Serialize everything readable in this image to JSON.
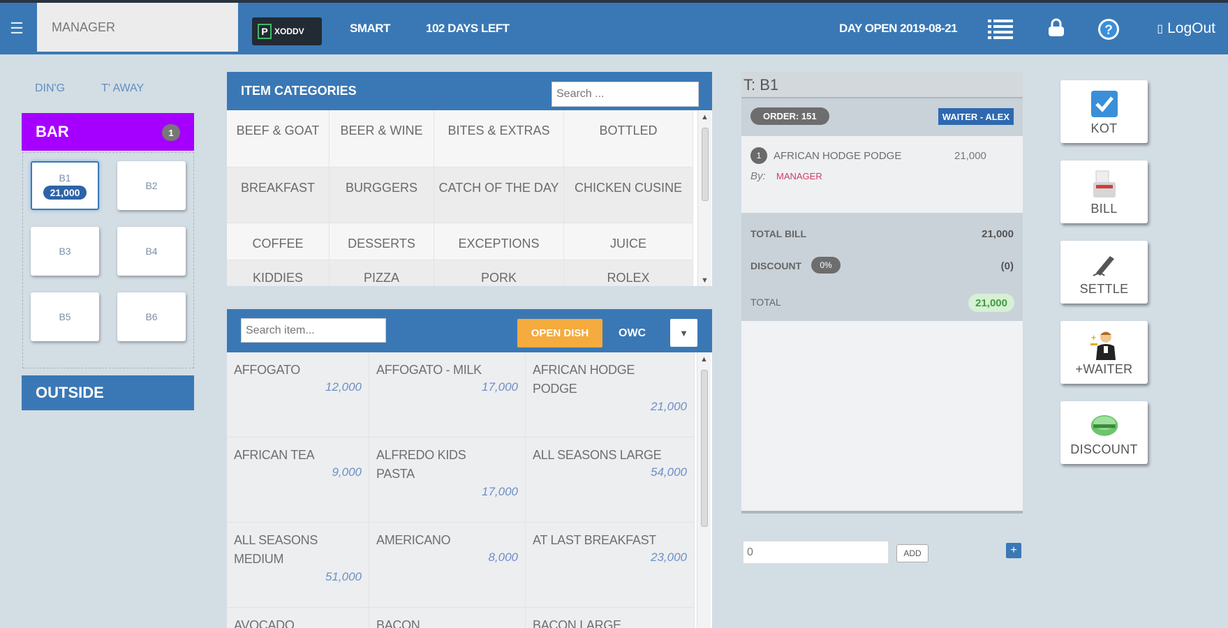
{
  "header": {
    "user": "MANAGER",
    "brand_mark": "P",
    "brand_text": "XODDV",
    "plan": "SMART",
    "days_left": "102 DAYS LEFT",
    "day_open": "DAY OPEN 2019-08-21",
    "logout": "LogOut"
  },
  "left": {
    "tabs": [
      "DIN'G",
      "T' AWAY"
    ],
    "section_bar": {
      "label": "BAR",
      "count": "1"
    },
    "tables": [
      {
        "name": "B1",
        "amount": "21,000"
      },
      {
        "name": "B2"
      },
      {
        "name": "B3"
      },
      {
        "name": "B4"
      },
      {
        "name": "B5"
      },
      {
        "name": "B6"
      }
    ],
    "section_outside": "OUTSIDE"
  },
  "categories": {
    "title": "ITEM CATEGORIES",
    "search_placeholder": "Search ...",
    "items": [
      "BEEF & GOAT",
      "BEER & WINE",
      "BITES & EXTRAS",
      "BOTTLED",
      "BREAKFAST",
      "BURGGERS",
      "CATCH OF THE DAY",
      "CHICKEN CUSINE",
      "COFFEE",
      "DESSERTS",
      "EXCEPTIONS",
      "JUICE",
      "KIDDIES",
      "PIZZA",
      "PORK",
      "ROLEX"
    ]
  },
  "menu_items": {
    "search_placeholder": "Search item...",
    "open_dish": "OPEN DISH",
    "owc": "OWC",
    "items": [
      {
        "name": "AFFOGATO",
        "price": "12,000"
      },
      {
        "name": "AFFOGATO - MILK",
        "price": "17,000"
      },
      {
        "name": "AFRICAN HODGE PODGE",
        "price": "21,000"
      },
      {
        "name": "AFRICAN TEA",
        "price": "9,000"
      },
      {
        "name": "ALFREDO KIDS PASTA",
        "price": "17,000"
      },
      {
        "name": "ALL SEASONS LARGE",
        "price": "54,000"
      },
      {
        "name": "ALL SEASONS MEDIUM",
        "price": "51,000"
      },
      {
        "name": "AMERICANO",
        "price": "8,000"
      },
      {
        "name": "AT LAST BREAKFAST",
        "price": "23,000"
      },
      {
        "name": "AVOCADO",
        "price": ""
      },
      {
        "name": "BACON",
        "price": ""
      },
      {
        "name": "BACON LARGE",
        "price": ""
      }
    ]
  },
  "order": {
    "title": "T: B1",
    "order_no": "ORDER: 151",
    "waiter": "WAITER - ALEX",
    "line": {
      "qty": "1",
      "name": "AFRICAN HODGE PODGE",
      "amount": "21,000",
      "by_label": "By:",
      "by_name": "MANAGER"
    },
    "total_bill_label": "TOTAL BILL",
    "total_bill": "21,000",
    "discount_label": "DISCOUNT",
    "discount_pct": "0%",
    "discount_val": "(0)",
    "total_label": "TOTAL",
    "total": "21,000",
    "add_input": "0",
    "add_label": "ADD",
    "plus": "+"
  },
  "actions": [
    {
      "label": "KOT"
    },
    {
      "label": "BILL"
    },
    {
      "label": "SETTLE"
    },
    {
      "label": "+WAITER"
    },
    {
      "label": "DISCOUNT"
    }
  ]
}
